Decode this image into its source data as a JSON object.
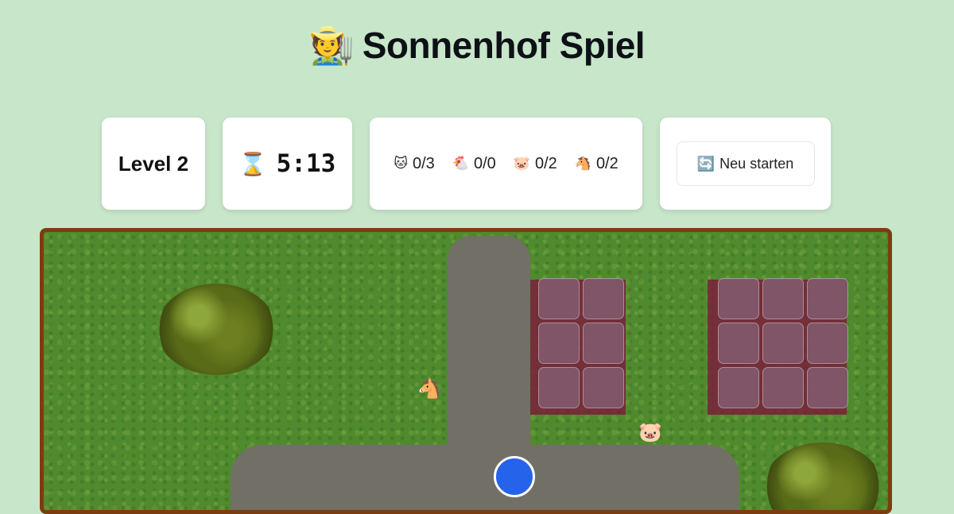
{
  "header": {
    "emoji": "🧑‍🌾",
    "title": "Sonnenhof Spiel"
  },
  "level": {
    "label": "Level 2"
  },
  "timer": {
    "icon": "hourglass-icon",
    "glyph": "⌛",
    "value": "5:13"
  },
  "counts": [
    {
      "animal": "cat",
      "glyph": "🐱",
      "value": "0/3"
    },
    {
      "animal": "chicken",
      "glyph": "🐔",
      "value": "0/0"
    },
    {
      "animal": "pig",
      "glyph": "🐷",
      "value": "0/2"
    },
    {
      "animal": "horse",
      "glyph": "🐴",
      "value": "0/2"
    }
  ],
  "restart": {
    "glyph": "🔄",
    "label": "Neu starten"
  },
  "field": {
    "animals": [
      {
        "name": "horse",
        "glyph": "🐴"
      },
      {
        "name": "pig",
        "glyph": "🐷"
      }
    ]
  },
  "colors": {
    "background": "#c8e6c9",
    "fence": "#7b3d10",
    "player": "#2563eb",
    "pen": "#7a1e3a"
  }
}
